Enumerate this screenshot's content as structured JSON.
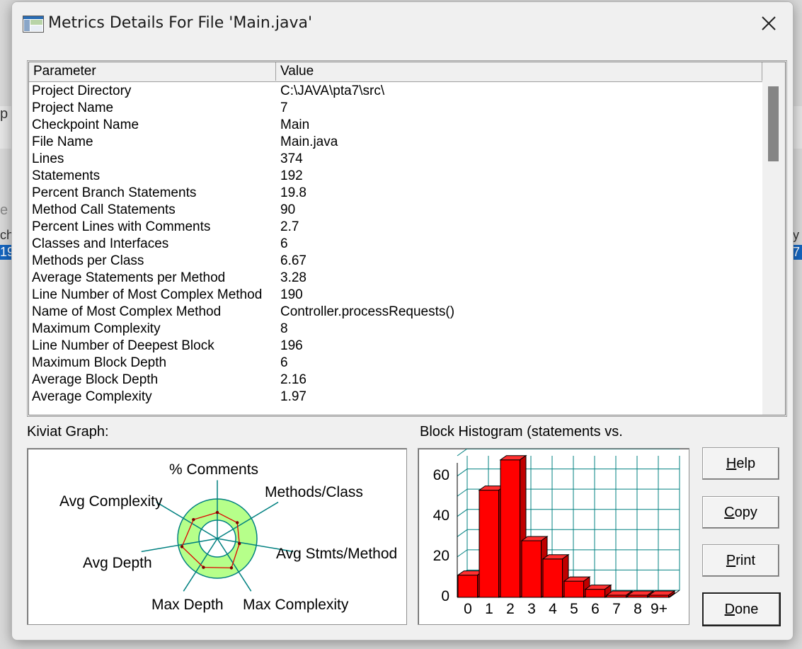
{
  "window": {
    "title": "Metrics Details For File 'Main.java'"
  },
  "background_fragments": [
    "p",
    "e",
    "ch",
    "19",
    "y",
    "7"
  ],
  "table": {
    "columns": [
      "Parameter",
      "Value"
    ],
    "rows": [
      [
        "Project Directory",
        "C:\\JAVA\\pta7\\src\\"
      ],
      [
        "Project Name",
        "7"
      ],
      [
        "Checkpoint Name",
        "Main"
      ],
      [
        "File Name",
        "Main.java"
      ],
      [
        "Lines",
        "374"
      ],
      [
        "Statements",
        "192"
      ],
      [
        "Percent Branch Statements",
        "19.8"
      ],
      [
        "Method Call Statements",
        "90"
      ],
      [
        "Percent Lines with Comments",
        "2.7"
      ],
      [
        "Classes and Interfaces",
        "6"
      ],
      [
        "Methods per Class",
        "6.67"
      ],
      [
        "Average Statements per Method",
        "3.28"
      ],
      [
        "Line Number of Most Complex Method",
        "190"
      ],
      [
        "Name of Most Complex Method",
        "Controller.processRequests()"
      ],
      [
        "Maximum Complexity",
        "8"
      ],
      [
        "Line Number of Deepest Block",
        "196"
      ],
      [
        "Maximum Block Depth",
        "6"
      ],
      [
        "Average Block Depth",
        "2.16"
      ],
      [
        "Average Complexity",
        "1.97"
      ]
    ]
  },
  "kiviat": {
    "label": "Kiviat Graph:",
    "axes": [
      "% Comments",
      "Methods/Class",
      "Avg Stmts/Method",
      "Max Complexity",
      "Max Depth",
      "Avg Depth",
      "Avg Complexity"
    ],
    "values_relative_to_ring": [
      0.9,
      0.88,
      0.78,
      1.12,
      1.1,
      1.25,
      1.05
    ],
    "colors": {
      "ring_fill": "#b6ff8a",
      "ring_stroke": "#008080",
      "axis": "#008080",
      "polygon": "#e00000"
    }
  },
  "histogram": {
    "label": "Block Histogram (statements vs.",
    "chart_data": {
      "type": "bar",
      "categories": [
        "0",
        "1",
        "2",
        "3",
        "4",
        "5",
        "6",
        "7",
        "8",
        "9+"
      ],
      "values": [
        11,
        53,
        68,
        28,
        19,
        8,
        4,
        0,
        0,
        0
      ],
      "yticks": [
        "0",
        "20",
        "40",
        "60"
      ],
      "ylim": [
        0,
        70
      ],
      "grid": true,
      "bar_color": "#ff0000",
      "grid_color": "#008080"
    }
  },
  "buttons": [
    {
      "id": "help",
      "mnemonic": "H",
      "rest": "elp"
    },
    {
      "id": "copy",
      "mnemonic": "C",
      "rest": "opy"
    },
    {
      "id": "print",
      "mnemonic": "P",
      "rest": "rint"
    },
    {
      "id": "done",
      "mnemonic": "D",
      "rest": "one"
    }
  ]
}
